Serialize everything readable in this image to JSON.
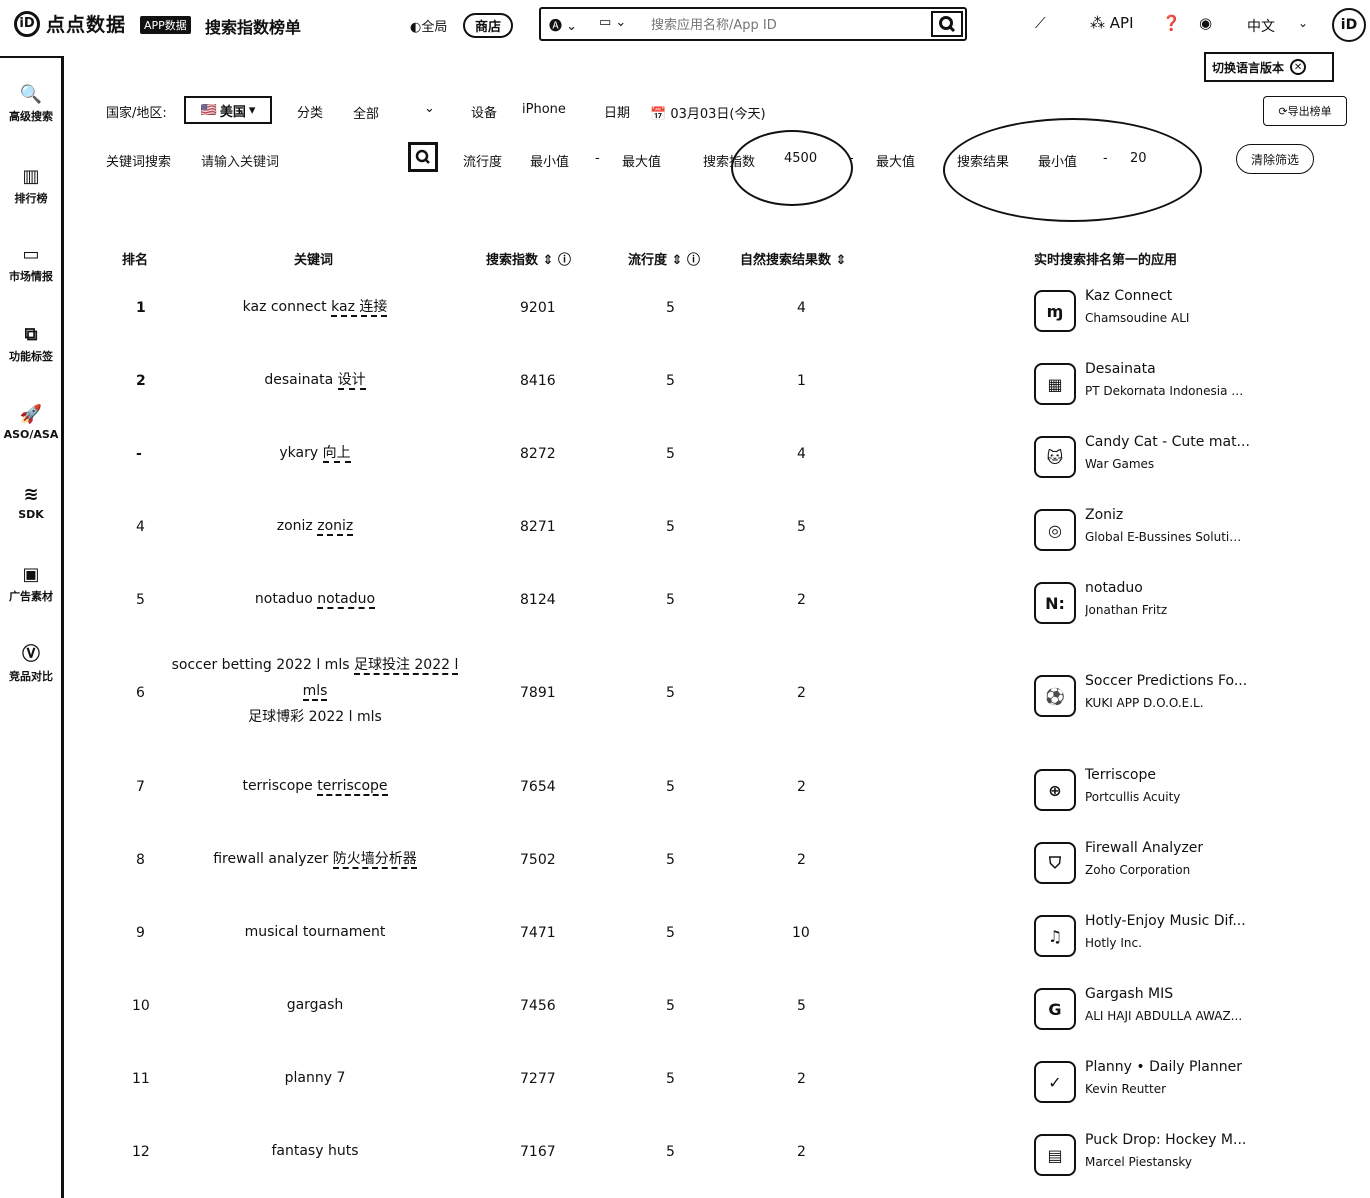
{
  "header": {
    "logo_mark": "iD",
    "logo_text": "点点数据",
    "badge": "APP数据",
    "title": "搜索指数榜单",
    "scope_all": "全局",
    "scope_store": "商店",
    "search_placeholder": "搜索应用名称/App ID",
    "api_label": "API",
    "language": "中文",
    "avatar_text": "iD",
    "tooltip": "切换语言版本"
  },
  "sidebar": {
    "items": [
      {
        "label": "高级搜索",
        "icon": "search-icon"
      },
      {
        "label": "排行榜",
        "icon": "chart-icon"
      },
      {
        "label": "市场情报",
        "icon": "market-icon"
      },
      {
        "label": "功能标签",
        "icon": "tag-icon"
      },
      {
        "label": "ASO/ASA",
        "icon": "rocket-icon"
      },
      {
        "label": "SDK",
        "icon": "layers-icon"
      },
      {
        "label": "广告素材",
        "icon": "ad-icon"
      },
      {
        "label": "竞品对比",
        "icon": "vs-icon"
      }
    ]
  },
  "filters": {
    "country_label": "国家/地区:",
    "country_value": "美国",
    "category_label": "分类",
    "category_value": "全部",
    "device_label": "设备",
    "device_value": "iPhone",
    "date_label": "日期",
    "date_value": "03月03日(今天)",
    "export": "导出榜单",
    "kw_label": "关键词搜索",
    "kw_placeholder": "请输入关键词",
    "popularity_label": "流行度",
    "popularity_min": "最小值",
    "popularity_max": "最大值",
    "index_label": "搜索指数",
    "index_min": "4500",
    "index_max": "最大值",
    "results_label": "搜索结果",
    "results_min": "最小值",
    "results_max": "20",
    "clear": "清除筛选",
    "dash": "-"
  },
  "table": {
    "headers": {
      "rank": "排名",
      "keyword": "关键词",
      "index": "搜索指数",
      "popularity": "流行度",
      "results": "自然搜索结果数",
      "top_app": "实时搜索排名第一的应用"
    },
    "rows": [
      {
        "rank": "1",
        "kw": "kaz connect ",
        "tr": "kaz 连接",
        "kw2": "",
        "index": "9201",
        "pop": "5",
        "res": "4",
        "app": "Kaz Connect",
        "dev": "Chamsoudine ALI",
        "icon": "ɱ"
      },
      {
        "rank": "2",
        "kw": "desainata ",
        "tr": "设计",
        "kw2": "",
        "index": "8416",
        "pop": "5",
        "res": "1",
        "app": "Desainata",
        "dev": "PT Dekornata Indonesia B...",
        "icon": "▦"
      },
      {
        "rank": "-",
        "kw": "ykary ",
        "tr": "向上",
        "kw2": "",
        "index": "8272",
        "pop": "5",
        "res": "4",
        "app": "Candy Cat - Cute mat...",
        "dev": "War Games",
        "icon": "🐱"
      },
      {
        "rank": "4",
        "kw": "zoniz ",
        "tr": "zoniz",
        "kw2": "",
        "index": "8271",
        "pop": "5",
        "res": "5",
        "app": "Zoniz",
        "dev": "Global E-Bussines Solutio...",
        "icon": "◎"
      },
      {
        "rank": "5",
        "kw": "notaduo ",
        "tr": "notaduo",
        "kw2": "",
        "index": "8124",
        "pop": "5",
        "res": "2",
        "app": "notaduo",
        "dev": "Jonathan Fritz",
        "icon": "N:"
      },
      {
        "rank": "6",
        "kw": "soccer betting 2022 l mls ",
        "tr": "足球投注 2022 l mls",
        "kw2": "足球博彩 2022 l mls",
        "index": "7891",
        "pop": "5",
        "res": "2",
        "app": "Soccer Predictions Fo...",
        "dev": "KUKI APP D.O.O.E.L.",
        "icon": "⚽"
      },
      {
        "rank": "7",
        "kw": "terriscope ",
        "tr": "terriscope",
        "kw2": "",
        "index": "7654",
        "pop": "5",
        "res": "2",
        "app": "Terriscope",
        "dev": "Portcullis Acuity",
        "icon": "⊕"
      },
      {
        "rank": "8",
        "kw": "firewall analyzer ",
        "tr": "防火墙分析器",
        "kw2": "",
        "index": "7502",
        "pop": "5",
        "res": "2",
        "app": "Firewall Analyzer",
        "dev": "Zoho Corporation",
        "icon": "⛉"
      },
      {
        "rank": "9",
        "kw": "musical tournament",
        "tr": "",
        "kw2": "",
        "index": "7471",
        "pop": "5",
        "res": "10",
        "app": "Hotly-Enjoy Music Dif...",
        "dev": "Hotly Inc.",
        "icon": "♫"
      },
      {
        "rank": "10",
        "kw": "gargash",
        "tr": "",
        "kw2": "",
        "index": "7456",
        "pop": "5",
        "res": "5",
        "app": "Gargash MIS",
        "dev": "ALI HAJI ABDULLA AWAZ...",
        "icon": "G"
      },
      {
        "rank": "11",
        "kw": "planny 7",
        "tr": "",
        "kw2": "",
        "index": "7277",
        "pop": "5",
        "res": "2",
        "app": "Planny • Daily Planner",
        "dev": "Kevin Reutter",
        "icon": "✓"
      },
      {
        "rank": "12",
        "kw": "fantasy huts",
        "tr": "",
        "kw2": "",
        "index": "7167",
        "pop": "5",
        "res": "2",
        "app": "Puck Drop: Hockey M...",
        "dev": "Marcel Piestansky",
        "icon": "▤"
      }
    ]
  }
}
